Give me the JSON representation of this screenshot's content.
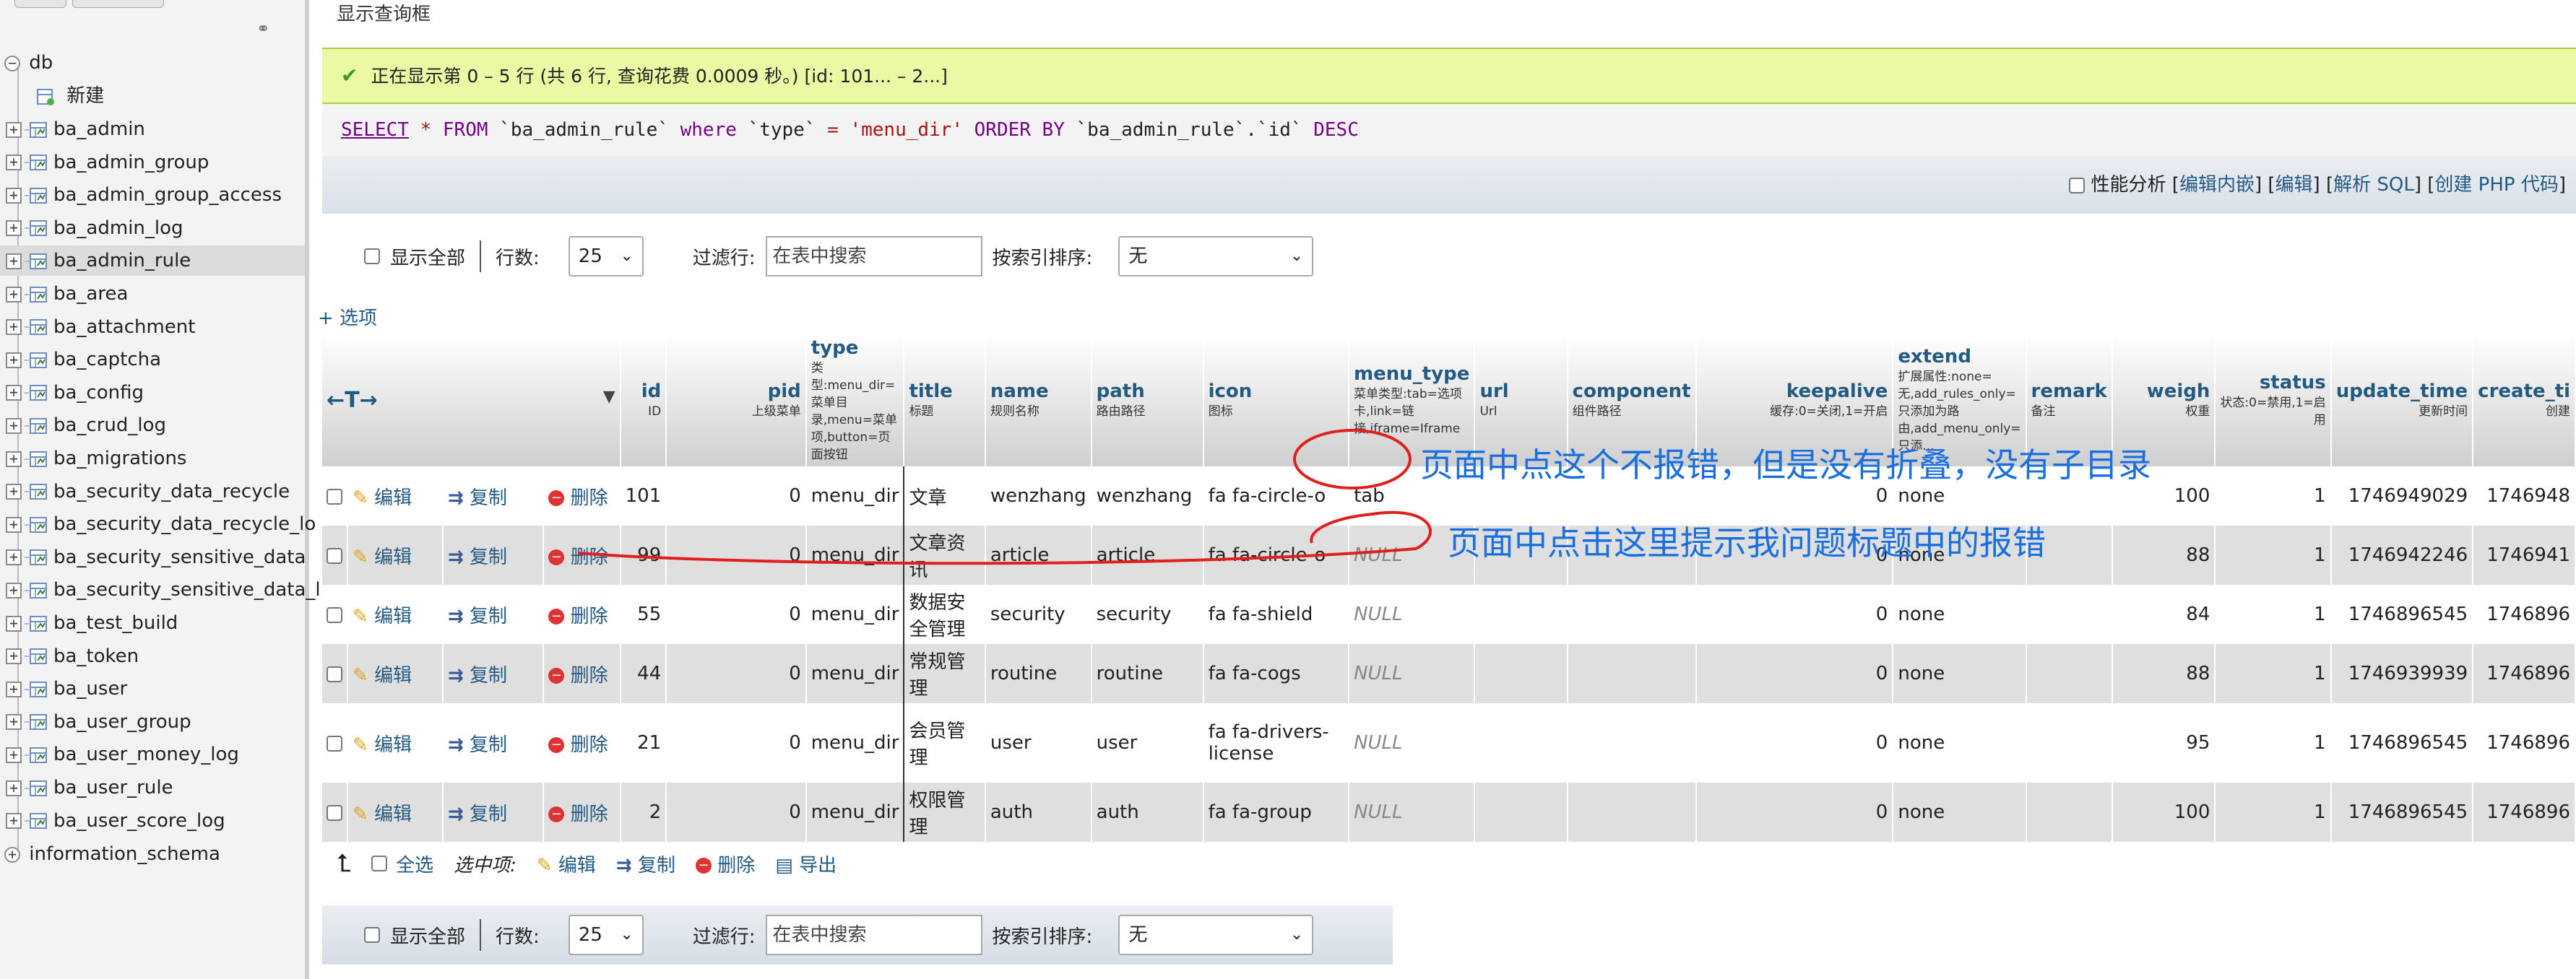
{
  "sidebar": {
    "db_name": "db",
    "new_label": "新建",
    "tables": [
      "ba_admin",
      "ba_admin_group",
      "ba_admin_group_access",
      "ba_admin_log",
      "ba_admin_rule",
      "ba_area",
      "ba_attachment",
      "ba_captcha",
      "ba_config",
      "ba_crud_log",
      "ba_migrations",
      "ba_security_data_recycle",
      "ba_security_data_recycle_lo",
      "ba_security_sensitive_data",
      "ba_security_sensitive_data_l",
      "ba_test_build",
      "ba_token",
      "ba_user",
      "ba_user_group",
      "ba_user_money_log",
      "ba_user_rule",
      "ba_user_score_log"
    ],
    "selected": "ba_admin_rule",
    "other_db": "information_schema"
  },
  "main": {
    "title": "显示查询框",
    "success_msg": "正在显示第 0 – 5 行 (共 6 行, 查询花费 0.0009 秒。) [id: 101... – 2...]",
    "sql": {
      "select": "SELECT",
      "star": " * ",
      "from": "FROM",
      "table": " `ba_admin_rule` ",
      "where": "where",
      "col": " `type` ",
      "eq": "=",
      "val": " 'menu_dir' ",
      "order": "ORDER BY",
      "ordcol": " `ba_admin_rule`.`id` ",
      "desc": "DESC"
    },
    "opbar": {
      "profiling": "性能分析",
      "edit_inline": "编辑内嵌",
      "edit": "编辑",
      "explain": "解析 SQL",
      "php": "创建 PHP 代码",
      "open": "[",
      "close": "]",
      "mid": "] ["
    },
    "nav": {
      "show_all": "显示全部",
      "rows_label": "行数:",
      "rows_value": "25",
      "filter_label": "过滤行:",
      "filter_placeholder": "在表中搜索",
      "sort_label": "按索引排序:",
      "sort_value": "无"
    },
    "options_link": "+ 选项",
    "columns": [
      {
        "name": "id",
        "sub": "ID"
      },
      {
        "name": "pid",
        "sub": "上级菜单"
      },
      {
        "name": "type",
        "sub": "类型:menu_dir=菜单目录,menu=菜单项,button=页面按钮"
      },
      {
        "name": "title",
        "sub": "标题"
      },
      {
        "name": "name",
        "sub": "规则名称"
      },
      {
        "name": "path",
        "sub": "路由路径"
      },
      {
        "name": "icon",
        "sub": "图标"
      },
      {
        "name": "menu_type",
        "sub": "菜单类型:tab=选项卡,link=链接,iframe=Iframe"
      },
      {
        "name": "url",
        "sub": "Url"
      },
      {
        "name": "component",
        "sub": "组件路径"
      },
      {
        "name": "keepalive",
        "sub": "缓存:0=关闭,1=开启"
      },
      {
        "name": "extend",
        "sub": "扩展属性:none=无,add_rules_only=只添加为路由,add_menu_only=只添..."
      },
      {
        "name": "remark",
        "sub": "备注"
      },
      {
        "name": "weigh",
        "sub": "权重"
      },
      {
        "name": "status",
        "sub": "状态:0=禁用,1=启用"
      },
      {
        "name": "update_time",
        "sub": "更新时间"
      },
      {
        "name": "create_ti",
        "sub": "创建"
      }
    ],
    "actions": {
      "edit": "编辑",
      "copy": "复制",
      "delete": "删除"
    },
    "rows": [
      {
        "id": "101",
        "pid": "0",
        "type": "menu_dir",
        "title": "文章",
        "name": "wenzhang",
        "path": "wenzhang",
        "icon": "fa fa-circle-o",
        "menu_type": "tab",
        "keepalive": "0",
        "extend": "none",
        "weigh": "100",
        "status": "1",
        "update_time": "1746949029",
        "create_time": "1746948"
      },
      {
        "id": "99",
        "pid": "0",
        "type": "menu_dir",
        "title": "文章资讯",
        "name": "article",
        "path": "article",
        "icon": "fa fa-circle-o",
        "menu_type": "NULL",
        "keepalive": "0",
        "extend": "none",
        "weigh": "88",
        "status": "1",
        "update_time": "1746942246",
        "create_time": "1746941"
      },
      {
        "id": "55",
        "pid": "0",
        "type": "menu_dir",
        "title": "数据安全管理",
        "name": "security",
        "path": "security",
        "icon": "fa fa-shield",
        "menu_type": "NULL",
        "keepalive": "0",
        "extend": "none",
        "weigh": "84",
        "status": "1",
        "update_time": "1746896545",
        "create_time": "1746896"
      },
      {
        "id": "44",
        "pid": "0",
        "type": "menu_dir",
        "title": "常规管理",
        "name": "routine",
        "path": "routine",
        "icon": "fa fa-cogs",
        "menu_type": "NULL",
        "keepalive": "0",
        "extend": "none",
        "weigh": "88",
        "status": "1",
        "update_time": "1746939939",
        "create_time": "1746896"
      },
      {
        "id": "21",
        "pid": "0",
        "type": "menu_dir",
        "title": "会员管理",
        "name": "user",
        "path": "user",
        "icon": "fa fa-drivers-license",
        "menu_type": "NULL",
        "keepalive": "0",
        "extend": "none",
        "weigh": "95",
        "status": "1",
        "update_time": "1746896545",
        "create_time": "1746896"
      },
      {
        "id": "2",
        "pid": "0",
        "type": "menu_dir",
        "title": "权限管理",
        "name": "auth",
        "path": "auth",
        "icon": "fa fa-group",
        "menu_type": "NULL",
        "keepalive": "0",
        "extend": "none",
        "weigh": "100",
        "status": "1",
        "update_time": "1746896545",
        "create_time": "1746896"
      }
    ],
    "bottom": {
      "select_all": "全选",
      "with_selected": "选中项:",
      "edit": "编辑",
      "copy": "复制",
      "delete": "删除",
      "export": "导出"
    },
    "annotations": {
      "a1": "页面中点这个不报错，但是没有折叠，没有子目录",
      "a2": "页面中点击这里提示我问题标题中的报错"
    }
  }
}
